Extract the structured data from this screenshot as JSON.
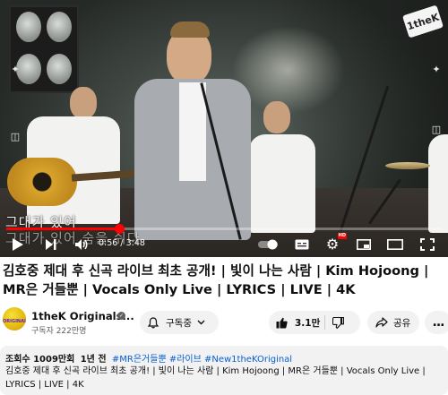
{
  "player": {
    "subtitle_lines": [
      "그대가 있어",
      "그대가 있어 숨을 쉬다"
    ],
    "time_current": "0:56",
    "time_total": "3:48",
    "time_separator": " / ",
    "progress": 0.2586,
    "corner_logo": "1theK",
    "hd_badge": "HD",
    "accent_color": "#ff0000"
  },
  "video": {
    "title": "김호중 제대 후 신곡 라이브 최초 공개! | 빛이 나는 사람 | Kim Hojoong | MR은 거들뿐 | Vocals Only Live | LYRICS | LIVE | 4K"
  },
  "channel": {
    "name": "1theK Originals...",
    "subscribers": "구독자 222만명",
    "avatar_text": "ORIGINALS",
    "subscribe_label": "구독중"
  },
  "actions": {
    "like_count": "3.1만",
    "share_label": "공유",
    "more_label": "..."
  },
  "description": {
    "views": "조회수 1009만회",
    "age": "1년 전",
    "tags": "#MR은거들뿐 #라이브 #New1theKOriginal",
    "text": "김호중 제대 후 신곡 라이브 최초 공개! | 빛이 나는 사람 | Kim Hojoong | MR은 거들뿐 | Vocals Only Live | LYRICS | LIVE | 4K"
  },
  "colors": {
    "link": "#065fd4",
    "pill_bg": "#f2f2f2",
    "muted_text": "#606060"
  }
}
